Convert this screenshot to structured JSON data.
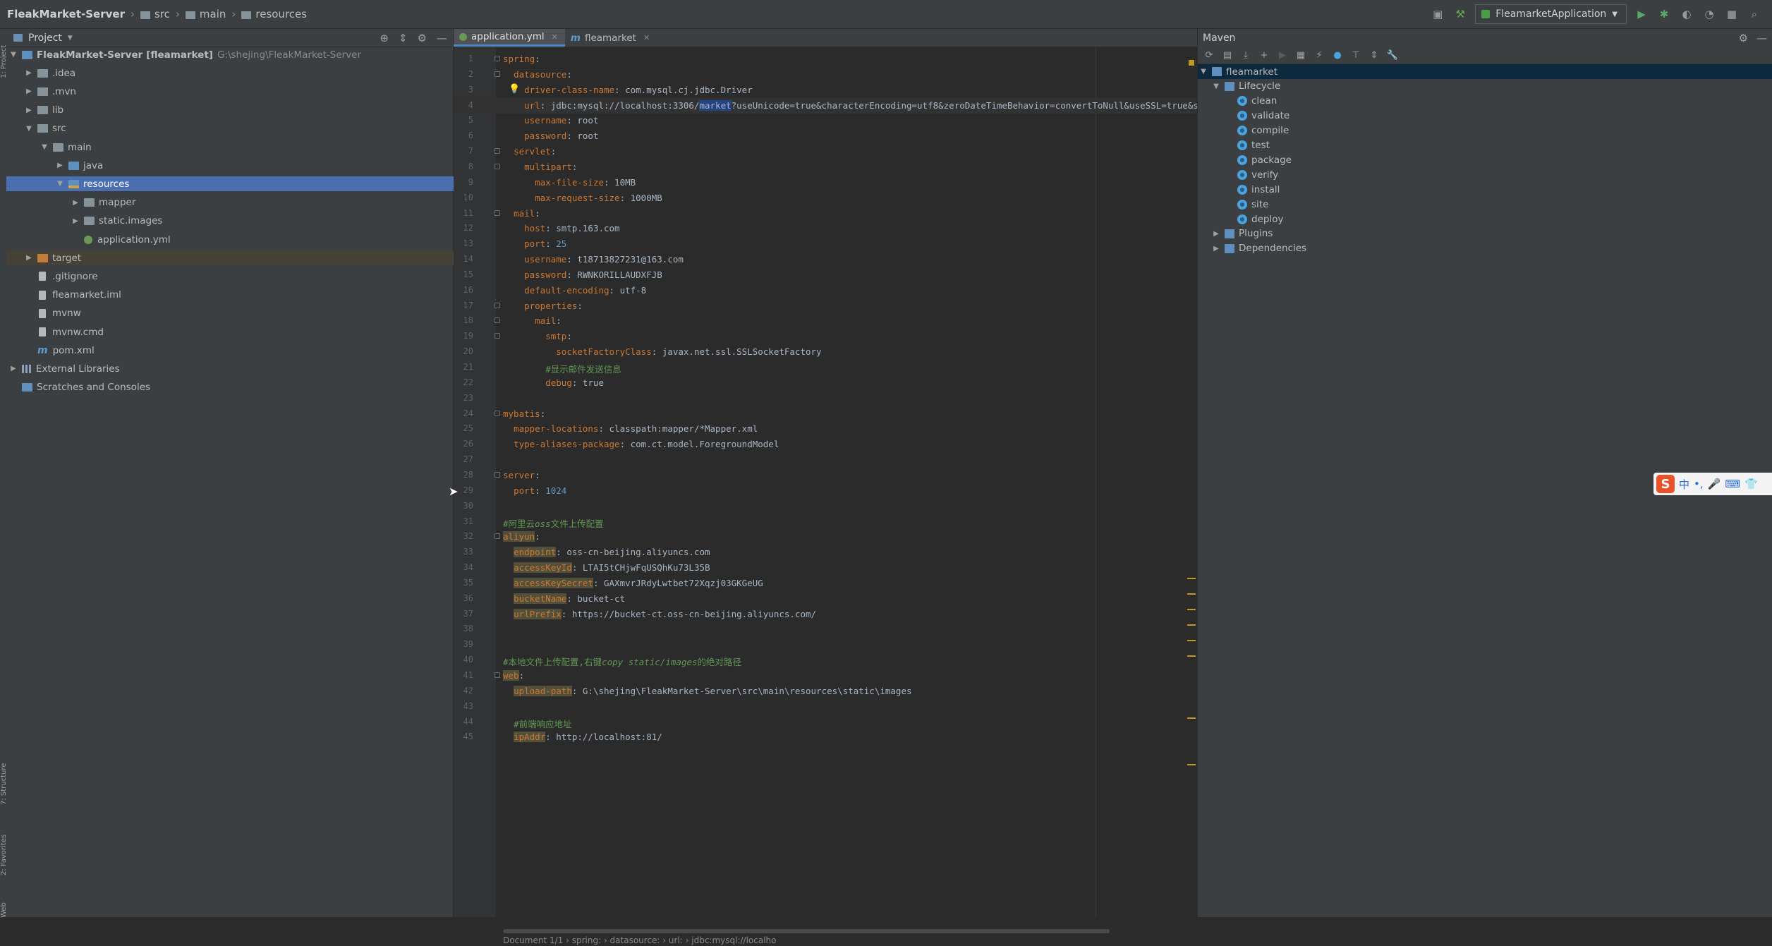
{
  "navbar": {
    "crumbs": [
      "FleakMarket-Server",
      "src",
      "main",
      "resources"
    ],
    "run_config": "FleamarketApplication"
  },
  "project": {
    "title": "Project",
    "tree": [
      {
        "label": "FleakMarket-Server",
        "module": "[fleamarket]",
        "path": "G:\\shejing\\FleakMarket-Server",
        "depth": 0,
        "expanded": true,
        "icon": "module-folder"
      },
      {
        "label": ".idea",
        "depth": 1,
        "expanded": false,
        "icon": "folder"
      },
      {
        "label": ".mvn",
        "depth": 1,
        "expanded": false,
        "icon": "folder"
      },
      {
        "label": "lib",
        "depth": 1,
        "expanded": false,
        "icon": "folder"
      },
      {
        "label": "src",
        "depth": 1,
        "expanded": true,
        "icon": "folder"
      },
      {
        "label": "main",
        "depth": 2,
        "expanded": true,
        "icon": "folder"
      },
      {
        "label": "java",
        "depth": 3,
        "expanded": false,
        "icon": "source-folder"
      },
      {
        "label": "resources",
        "depth": 3,
        "expanded": true,
        "icon": "resources-folder",
        "selected": true
      },
      {
        "label": "mapper",
        "depth": 4,
        "expanded": false,
        "icon": "folder"
      },
      {
        "label": "static.images",
        "depth": 4,
        "expanded": false,
        "icon": "folder"
      },
      {
        "label": "application.yml",
        "depth": 4,
        "icon": "yml-file"
      },
      {
        "label": "target",
        "depth": 1,
        "expanded": false,
        "icon": "excluded-folder",
        "target": true
      },
      {
        "label": ".gitignore",
        "depth": 1,
        "icon": "file"
      },
      {
        "label": "fleamarket.iml",
        "depth": 1,
        "icon": "file"
      },
      {
        "label": "mvnw",
        "depth": 1,
        "icon": "file"
      },
      {
        "label": "mvnw.cmd",
        "depth": 1,
        "icon": "file"
      },
      {
        "label": "pom.xml",
        "depth": 1,
        "icon": "maven-file"
      },
      {
        "label": "External Libraries",
        "depth": 0,
        "expanded": false,
        "icon": "library"
      },
      {
        "label": "Scratches and Consoles",
        "depth": 0,
        "icon": "scratches"
      }
    ]
  },
  "editor": {
    "tabs": [
      {
        "label": "application.yml",
        "active": true,
        "icon": "yml-icon"
      },
      {
        "label": "fleamarket",
        "active": false,
        "icon": "maven-m-icon"
      }
    ],
    "lines": [
      [
        [
          "k",
          "spring"
        ],
        [
          "v",
          ":"
        ]
      ],
      [
        [
          "v",
          "  "
        ],
        [
          "k",
          "datasource"
        ],
        [
          "v",
          ":"
        ]
      ],
      [
        [
          "v",
          "    "
        ],
        [
          "k",
          "driver-class-name"
        ],
        [
          "v",
          ": "
        ],
        [
          "v",
          "com.mysql.cj.jdbc.Driver"
        ]
      ],
      [
        [
          "v",
          "    "
        ],
        [
          "k",
          "url"
        ],
        [
          "v",
          ": jdbc:mysql://localhost:3306/"
        ],
        [
          "hlb",
          "market"
        ],
        [
          "v",
          "?useUnicode=true&characterEncoding=utf8&zeroDateTimeBehavior=convertToNull&useSSL=true&serverTime"
        ]
      ],
      [
        [
          "v",
          "    "
        ],
        [
          "k",
          "username"
        ],
        [
          "v",
          ": root"
        ]
      ],
      [
        [
          "v",
          "    "
        ],
        [
          "k",
          "password"
        ],
        [
          "v",
          ": root"
        ]
      ],
      [
        [
          "v",
          "  "
        ],
        [
          "k",
          "servlet"
        ],
        [
          "v",
          ":"
        ]
      ],
      [
        [
          "v",
          "    "
        ],
        [
          "k",
          "multipart"
        ],
        [
          "v",
          ":"
        ]
      ],
      [
        [
          "v",
          "      "
        ],
        [
          "k",
          "max-file-size"
        ],
        [
          "v",
          ": 10MB"
        ]
      ],
      [
        [
          "v",
          "      "
        ],
        [
          "k",
          "max-request-size"
        ],
        [
          "v",
          ": 1000MB"
        ]
      ],
      [
        [
          "v",
          "  "
        ],
        [
          "k",
          "mail"
        ],
        [
          "v",
          ":"
        ]
      ],
      [
        [
          "v",
          "    "
        ],
        [
          "k",
          "host"
        ],
        [
          "v",
          ": smtp.163.com"
        ]
      ],
      [
        [
          "v",
          "    "
        ],
        [
          "k",
          "port"
        ],
        [
          "v",
          ": "
        ],
        [
          "n",
          "25"
        ]
      ],
      [
        [
          "v",
          "    "
        ],
        [
          "k",
          "username"
        ],
        [
          "v",
          ": t18713827231@163.com"
        ]
      ],
      [
        [
          "v",
          "    "
        ],
        [
          "k",
          "password"
        ],
        [
          "v",
          ": RWNKORILLAUDXFJB"
        ]
      ],
      [
        [
          "v",
          "    "
        ],
        [
          "k",
          "default-encoding"
        ],
        [
          "v",
          ": utf-8"
        ]
      ],
      [
        [
          "v",
          "    "
        ],
        [
          "k",
          "properties"
        ],
        [
          "v",
          ":"
        ]
      ],
      [
        [
          "v",
          "      "
        ],
        [
          "k",
          "mail"
        ],
        [
          "v",
          ":"
        ]
      ],
      [
        [
          "v",
          "        "
        ],
        [
          "k",
          "smtp"
        ],
        [
          "v",
          ":"
        ]
      ],
      [
        [
          "v",
          "          "
        ],
        [
          "k",
          "socketFactoryClass"
        ],
        [
          "v",
          ": javax.net.ssl.SSLSocketFactory"
        ]
      ],
      [
        [
          "v",
          "        "
        ],
        [
          "c",
          "#显示邮件发送信息"
        ]
      ],
      [
        [
          "v",
          "        "
        ],
        [
          "k",
          "debug"
        ],
        [
          "v",
          ": true"
        ]
      ],
      [],
      [
        [
          "k",
          "mybatis"
        ],
        [
          "v",
          ":"
        ]
      ],
      [
        [
          "v",
          "  "
        ],
        [
          "k",
          "mapper-locations"
        ],
        [
          "v",
          ": classpath:mapper/*Mapper.xml"
        ]
      ],
      [
        [
          "v",
          "  "
        ],
        [
          "k",
          "type-aliases-package"
        ],
        [
          "v",
          ": com.ct.model.ForegroundModel"
        ]
      ],
      [],
      [
        [
          "k",
          "server"
        ],
        [
          "v",
          ":"
        ]
      ],
      [
        [
          "v",
          "  "
        ],
        [
          "k",
          "port"
        ],
        [
          "v",
          ": "
        ],
        [
          "n",
          "1024"
        ]
      ],
      [],
      [
        [
          "c",
          "#阿里云"
        ],
        [
          "ci",
          "oss"
        ],
        [
          "c",
          "文件上传配置"
        ]
      ],
      [
        [
          "hk",
          "aliyun"
        ],
        [
          "v",
          ":"
        ]
      ],
      [
        [
          "v",
          "  "
        ],
        [
          "hk",
          "endpoint"
        ],
        [
          "v",
          ": oss-cn-beijing.aliyuncs.com"
        ]
      ],
      [
        [
          "v",
          "  "
        ],
        [
          "hk",
          "accessKeyId"
        ],
        [
          "v",
          ": LTAI5tCHjwFqUSQhKu73L35B"
        ]
      ],
      [
        [
          "v",
          "  "
        ],
        [
          "hk",
          "accessKeySecret"
        ],
        [
          "v",
          ": GAXmvrJRdyLwtbet72Xqzj03GKGeUG"
        ]
      ],
      [
        [
          "v",
          "  "
        ],
        [
          "hk",
          "bucketName"
        ],
        [
          "v",
          ": bucket-ct"
        ]
      ],
      [
        [
          "v",
          "  "
        ],
        [
          "hk",
          "urlPrefix"
        ],
        [
          "v",
          ": https://bucket-ct.oss-cn-beijing.aliyuncs.com/"
        ]
      ],
      [],
      [],
      [
        [
          "c",
          "#本地文件上传配置,右键"
        ],
        [
          "ci",
          "copy static/images"
        ],
        [
          "c",
          "的绝对路径"
        ]
      ],
      [
        [
          "hk",
          "web"
        ],
        [
          "v",
          ":"
        ]
      ],
      [
        [
          "v",
          "  "
        ],
        [
          "hk",
          "upload-path"
        ],
        [
          "v",
          ": G:\\shejing\\FleakMarket-Server\\src\\main\\resources\\static\\images"
        ]
      ],
      [],
      [
        [
          "v",
          "  "
        ],
        [
          "c",
          "#前端响应地址"
        ]
      ],
      [
        [
          "v",
          "  "
        ],
        [
          "hk",
          "ipAddr"
        ],
        [
          "v",
          ": http://localhost:81/"
        ]
      ]
    ],
    "breadcrumb": "Document 1/1  ›  spring:  ›  datasource:  ›  url:  ›  jdbc:mysql://localho"
  },
  "maven": {
    "title": "Maven",
    "tree": [
      {
        "label": "fleamarket",
        "depth": 0,
        "expanded": true,
        "icon": "maven-project",
        "selected": true
      },
      {
        "label": "Lifecycle",
        "depth": 1,
        "expanded": true,
        "icon": "folder"
      },
      {
        "label": "clean",
        "depth": 2,
        "icon": "gear"
      },
      {
        "label": "validate",
        "depth": 2,
        "icon": "gear"
      },
      {
        "label": "compile",
        "depth": 2,
        "icon": "gear"
      },
      {
        "label": "test",
        "depth": 2,
        "icon": "gear"
      },
      {
        "label": "package",
        "depth": 2,
        "icon": "gear"
      },
      {
        "label": "verify",
        "depth": 2,
        "icon": "gear"
      },
      {
        "label": "install",
        "depth": 2,
        "icon": "gear"
      },
      {
        "label": "site",
        "depth": 2,
        "icon": "gear"
      },
      {
        "label": "deploy",
        "depth": 2,
        "icon": "gear"
      },
      {
        "label": "Plugins",
        "depth": 1,
        "expanded": false,
        "icon": "folder"
      },
      {
        "label": "Dependencies",
        "depth": 1,
        "expanded": false,
        "icon": "folder"
      }
    ]
  },
  "ime": {
    "logo": "S",
    "mode": "中"
  },
  "colors": {
    "selection": "#4b6eaf",
    "keyword": "#cc7832",
    "comment": "#629755",
    "number": "#6897bb"
  }
}
